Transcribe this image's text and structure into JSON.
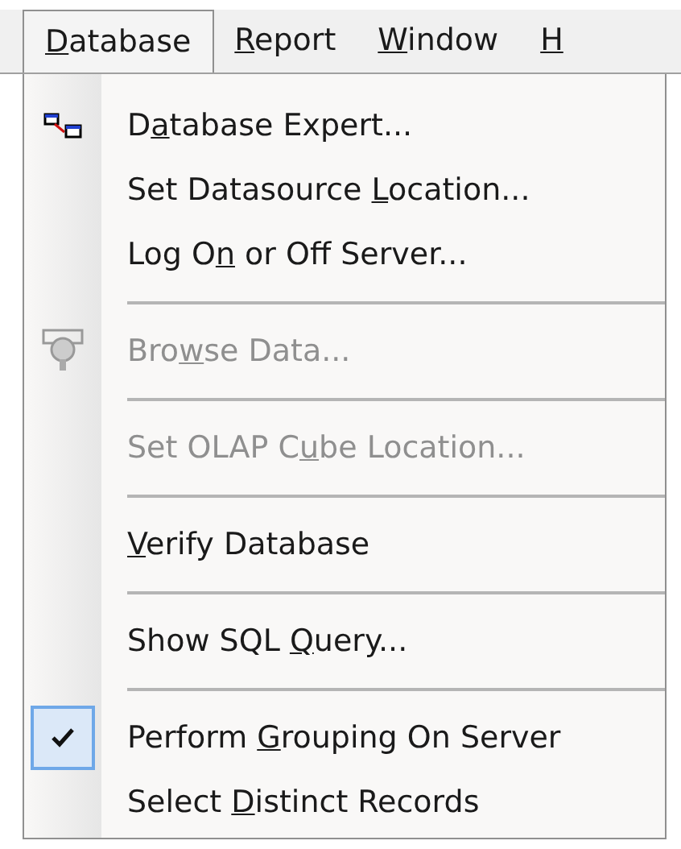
{
  "menu_bar": [
    {
      "label": {
        "key": "D",
        "after": "atabase"
      },
      "selected": true
    },
    {
      "label": {
        "key": "R",
        "after": "eport"
      },
      "selected": false
    },
    {
      "label": {
        "key": "W",
        "after": "indow"
      },
      "selected": false
    },
    {
      "label": {
        "key": "H"
      },
      "selected": false
    }
  ],
  "menu": [
    {
      "kind": "item",
      "label": {
        "before": "D",
        "key": "a",
        "after": "tabase Expert..."
      },
      "disabled": false,
      "checked": false
    },
    {
      "kind": "item",
      "label": {
        "before": "Set Datasource ",
        "key": "L",
        "after": "ocation..."
      },
      "disabled": false,
      "checked": false
    },
    {
      "kind": "item",
      "label": {
        "before": "Log O",
        "key": "n",
        "after": " or Off Server..."
      },
      "disabled": false,
      "checked": false
    },
    {
      "kind": "separator"
    },
    {
      "kind": "item",
      "label": {
        "before": "Bro",
        "key": "w",
        "after": "se Data..."
      },
      "disabled": true,
      "checked": false
    },
    {
      "kind": "separator"
    },
    {
      "kind": "item",
      "label": {
        "before": "Set OLAP C",
        "key": "u",
        "after": "be Location..."
      },
      "disabled": true,
      "checked": false
    },
    {
      "kind": "separator"
    },
    {
      "kind": "item",
      "label": {
        "key": "V",
        "after": "erify Database"
      },
      "disabled": false,
      "checked": false
    },
    {
      "kind": "separator"
    },
    {
      "kind": "item",
      "label": {
        "before": "Show SQL ",
        "key": "Q",
        "after": "uery..."
      },
      "disabled": false,
      "checked": false
    },
    {
      "kind": "separator"
    },
    {
      "kind": "item",
      "label": {
        "before": "Perform ",
        "key": "G",
        "after": "rouping On Server"
      },
      "disabled": false,
      "checked": true
    },
    {
      "kind": "item",
      "label": {
        "before": "Select ",
        "key": "D",
        "after": "istinct Records"
      },
      "disabled": false,
      "checked": false
    }
  ]
}
